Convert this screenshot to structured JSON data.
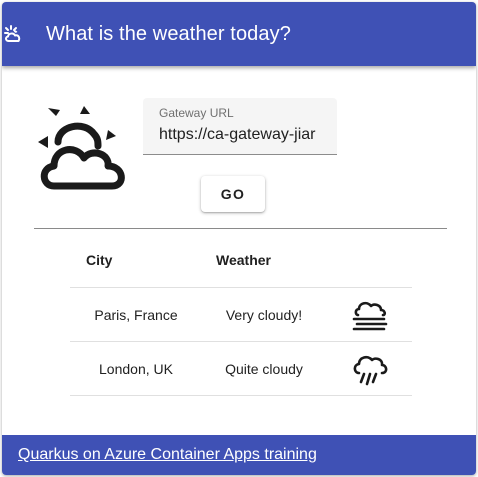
{
  "header": {
    "title": "What is the weather today?",
    "icon": "partly-cloudy-sun-icon",
    "color": "#3f51b5"
  },
  "hero": {
    "icon": "partly-cloudy-sun-icon"
  },
  "gateway": {
    "label": "Gateway URL",
    "value": "https://ca-gateway-jiar"
  },
  "go_button": {
    "label": "GO"
  },
  "table": {
    "headers": {
      "city": "City",
      "weather": "Weather"
    },
    "rows": [
      {
        "city": "Paris, France",
        "weather": "Very cloudy!",
        "icon": "fog-cloud-icon"
      },
      {
        "city": "London, UK",
        "weather": "Quite cloudy",
        "icon": "rain-cloud-icon"
      }
    ]
  },
  "footer": {
    "link_text": "Quarkus on Azure Container Apps training",
    "color": "#3f51b5"
  }
}
